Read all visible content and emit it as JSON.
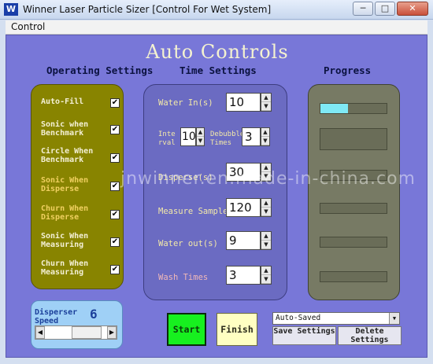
{
  "window": {
    "title": "Winner Laser Particle Sizer  [Control For Wet System]",
    "app_icon_glyph": "W"
  },
  "window_buttons": {
    "minimize": "─",
    "maximize": "□",
    "close": "✕"
  },
  "menu": {
    "items": [
      "Control"
    ]
  },
  "main_title": "Auto Controls",
  "headers": {
    "operating": "Operating Settings",
    "time": "Time Settings",
    "progress": "Progress"
  },
  "operating": [
    {
      "label": "Auto-Fill",
      "checked": true,
      "color": "#f4f0d6"
    },
    {
      "label": "Sonic when Benchmark",
      "checked": true,
      "color": "#f4f0d6"
    },
    {
      "label": "Circle When Benchmark",
      "checked": true,
      "color": "#f4f0d6"
    },
    {
      "label": "Sonic When Disperse",
      "checked": true,
      "color": "#f0d060"
    },
    {
      "label": "Churn When Disperse",
      "checked": true,
      "color": "#f0d060"
    },
    {
      "label": "Sonic When Measuring",
      "checked": true,
      "color": "#f4f0d6"
    },
    {
      "label": "Churn When Measuring",
      "checked": true,
      "color": "#f4f0d6"
    }
  ],
  "time_settings": {
    "water_in": {
      "label": "Water In(s)",
      "value": "10"
    },
    "interval": {
      "label": "Inte rval",
      "value": "10"
    },
    "debubble": {
      "label": "Debubble Times",
      "value": "3"
    },
    "disperse": {
      "label": "Disperse(s)",
      "value": "30"
    },
    "measure": {
      "label": "Measure Sample",
      "value": "120"
    },
    "water_out": {
      "label": "Water out(s)",
      "value": "9"
    },
    "wash": {
      "label": "Wash Times",
      "value": "3",
      "color": "#f0b8b8"
    }
  },
  "spin_glyphs": {
    "up": "▲",
    "down": "▼"
  },
  "progress": [
    0.42,
    0.0,
    0.0,
    0.0,
    0.0,
    0.0
  ],
  "disperser_speed": {
    "label": "Disperser Speed",
    "value": "6"
  },
  "scroll_glyphs": {
    "left": "◀",
    "right": "▶"
  },
  "buttons": {
    "start": "Start",
    "finish": "Finish",
    "save": "Save Settings",
    "delete": "Delete Settings"
  },
  "preset": {
    "selected": "Auto-Saved",
    "arrow": "▼"
  },
  "watermark": "jnwinner.en.made-in-china.com",
  "colors": {
    "accent_blue": "#7877d8",
    "start_green": "#17f01f",
    "progress_fill": "#7fe9f5"
  }
}
